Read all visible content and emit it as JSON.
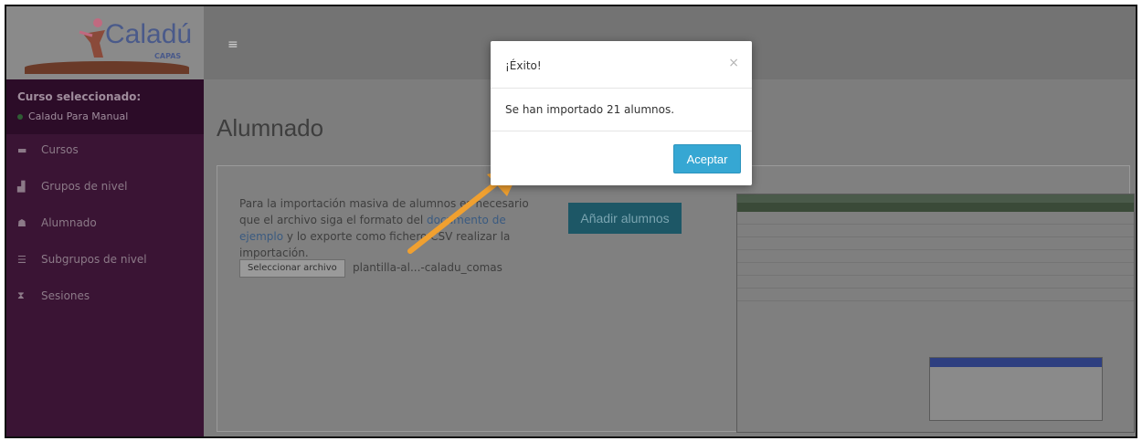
{
  "app": {
    "logo": "Caladú",
    "logo_sub": "CAPAS"
  },
  "sidebar": {
    "course_label": "Curso seleccionado:",
    "course_name": "Caladu Para Manual",
    "items": [
      {
        "label": "Cursos",
        "icon": "folder-icon"
      },
      {
        "label": "Grupos de nivel",
        "icon": "chart-icon"
      },
      {
        "label": "Alumnado",
        "icon": "users-icon"
      },
      {
        "label": "Subgrupos de nivel",
        "icon": "list-icon"
      },
      {
        "label": "Sesiones",
        "icon": "hourglass-icon"
      }
    ]
  },
  "main": {
    "title": "Alumnado",
    "import_text_1": "Para la importación masiva de alumnos es necesario que el archivo siga el formato del ",
    "import_link": "documento de ejemplo",
    "import_text_2": " y lo exporte como fichero CSV realizar la importación.",
    "add_button": "Añadir alumnos",
    "file_button": "Seleccionar archivo",
    "file_name": "plantilla-al...-caladu_comas"
  },
  "modal": {
    "title": "¡Éxito!",
    "close": "×",
    "message": "Se han importado 21 alumnos.",
    "accept": "Aceptar"
  },
  "colors": {
    "accent": "#36a7d3",
    "sidebar": "#3a1434",
    "annotation_arrow": "#f0a030"
  }
}
